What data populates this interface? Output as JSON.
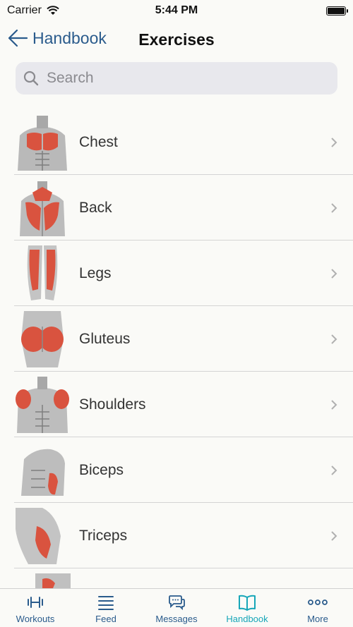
{
  "status": {
    "carrier": "Carrier",
    "time": "5:44 PM"
  },
  "nav": {
    "back_label": "Handbook",
    "title": "Exercises"
  },
  "search": {
    "placeholder": "Search"
  },
  "exercises": [
    {
      "label": "Chest",
      "thumb": "chest"
    },
    {
      "label": "Back",
      "thumb": "back"
    },
    {
      "label": "Legs",
      "thumb": "legs"
    },
    {
      "label": "Gluteus",
      "thumb": "gluteus"
    },
    {
      "label": "Shoulders",
      "thumb": "shoulders"
    },
    {
      "label": "Biceps",
      "thumb": "biceps"
    },
    {
      "label": "Triceps",
      "thumb": "triceps"
    }
  ],
  "tabs": [
    {
      "label": "Workouts",
      "icon": "dumbbell-icon"
    },
    {
      "label": "Feed",
      "icon": "list-icon"
    },
    {
      "label": "Messages",
      "icon": "chat-icon"
    },
    {
      "label": "Handbook",
      "icon": "book-icon",
      "active": true
    },
    {
      "label": "More",
      "icon": "more-icon"
    }
  ],
  "colors": {
    "accent": "#16a6b8",
    "link": "#2a5b8c",
    "muscle": "#d9533f"
  }
}
